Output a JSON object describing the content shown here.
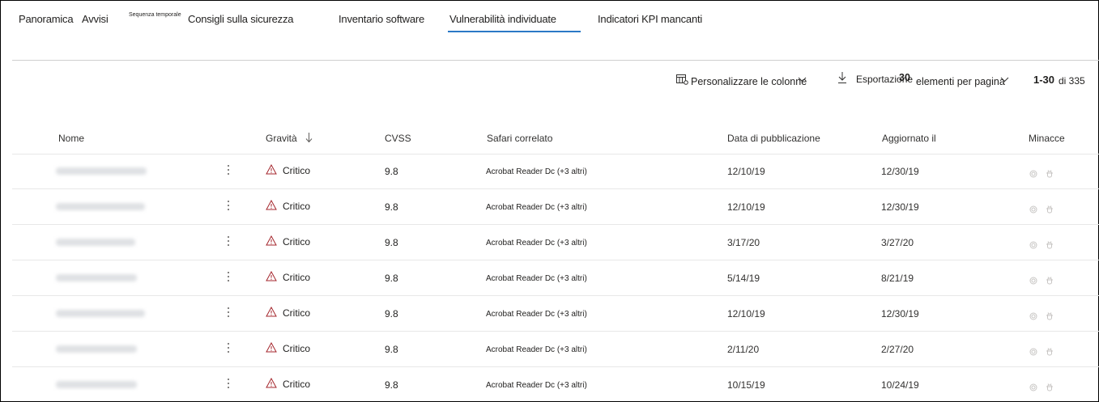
{
  "nav": {
    "tabs": [
      {
        "label": "Panoramica"
      },
      {
        "label": "Avvisi"
      },
      {
        "label": "Sequenza temporale"
      },
      {
        "label": "Consigli sulla sicurezza"
      },
      {
        "label": "Inventario software"
      },
      {
        "label": "Vulnerabilità individuate"
      },
      {
        "label": "Indicatori KPI mancanti"
      }
    ],
    "active_tab": "Vulnerabilità individuate",
    "accent_color": "#2b79c6"
  },
  "toolbar": {
    "customize_columns": "Personalizzare le colonne",
    "export": "Esportazione",
    "per_page_value": "30",
    "per_page_label": "elementi per pagina",
    "range": "1-30",
    "of_total": "di 335"
  },
  "table": {
    "headers": {
      "name": "Nome",
      "severity": "Gravità",
      "cvss": "CVSS",
      "related_software": "Safari correlato",
      "published": "Data di pubblicazione",
      "updated": "Aggiornato il",
      "threats": "Minacce"
    },
    "sort_column": "Gravità",
    "rows": [
      {
        "severity": "Critico",
        "cvss": "9.8",
        "software": "Acrobat Reader Dc (+3 altri)",
        "published": "12/10/19",
        "updated": "12/30/19"
      },
      {
        "severity": "Critico",
        "cvss": "9.8",
        "software": "Acrobat Reader Dc (+3 altri)",
        "published": "12/10/19",
        "updated": "12/30/19"
      },
      {
        "severity": "Critico",
        "cvss": "9.8",
        "software": "Acrobat Reader Dc (+3 altri)",
        "published": "3/17/20",
        "updated": "3/27/20"
      },
      {
        "severity": "Critico",
        "cvss": "9.8",
        "software": "Acrobat Reader Dc (+3 altri)",
        "published": "5/14/19",
        "updated": "8/21/19"
      },
      {
        "severity": "Critico",
        "cvss": "9.8",
        "software": "Acrobat Reader Dc (+3 altri)",
        "published": "12/10/19",
        "updated": "12/30/19"
      },
      {
        "severity": "Critico",
        "cvss": "9.8",
        "software": "Acrobat Reader Dc (+3 altri)",
        "published": "2/11/20",
        "updated": "2/27/20"
      },
      {
        "severity": "Critico",
        "cvss": "9.8",
        "software": "Acrobat Reader Dc (+3 altri)",
        "published": "10/15/19",
        "updated": "10/24/19"
      }
    ]
  }
}
